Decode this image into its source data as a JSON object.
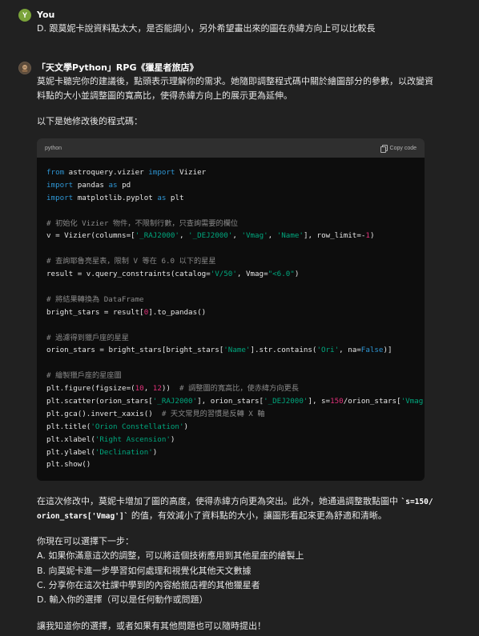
{
  "user": {
    "avatar_letter": "Y",
    "name": "You",
    "message": "D. 跟莫妮卡說資料點太大，是否能調小，另外希望畫出來的圖在赤緯方向上可以比較長"
  },
  "assistant": {
    "avatar_icon": "bot-avatar-icon",
    "name": "「天文學Python」RPG《獵星者旅店》",
    "intro_line1": "莫妮卡聽完你的建議後，點頭表示理解你的需求。她隨即調整程式碼中關於繪圖部分的參數，以改變資",
    "intro_line2": "料點的大小並調整圖的寬高比，使得赤緯方向上的展示更為延伸。",
    "lead": "以下是她修改後的程式碼：",
    "code": {
      "language": "python",
      "copy_label": "Copy code",
      "lines": [
        [
          {
            "t": "kw",
            "v": "from"
          },
          {
            "t": "fn",
            "v": " astroquery.vizier "
          },
          {
            "t": "kw",
            "v": "import"
          },
          {
            "t": "fn",
            "v": " Vizier"
          }
        ],
        [
          {
            "t": "kw",
            "v": "import"
          },
          {
            "t": "fn",
            "v": " pandas "
          },
          {
            "t": "kw",
            "v": "as"
          },
          {
            "t": "fn",
            "v": " pd"
          }
        ],
        [
          {
            "t": "kw",
            "v": "import"
          },
          {
            "t": "fn",
            "v": " matplotlib.pyplot "
          },
          {
            "t": "kw",
            "v": "as"
          },
          {
            "t": "fn",
            "v": " plt"
          }
        ],
        [],
        [
          {
            "t": "cmt",
            "v": "# 初始化 Vizier 物件，不限制行數，只查詢需要的欄位"
          }
        ],
        [
          {
            "t": "fn",
            "v": "v = Vizier(columns=["
          },
          {
            "t": "str",
            "v": "'_RAJ2000'"
          },
          {
            "t": "fn",
            "v": ", "
          },
          {
            "t": "str",
            "v": "'_DEJ2000'"
          },
          {
            "t": "fn",
            "v": ", "
          },
          {
            "t": "str",
            "v": "'Vmag'"
          },
          {
            "t": "fn",
            "v": ", "
          },
          {
            "t": "str",
            "v": "'Name'"
          },
          {
            "t": "fn",
            "v": "], row_limit=-"
          },
          {
            "t": "num",
            "v": "1"
          },
          {
            "t": "fn",
            "v": ")"
          }
        ],
        [],
        [
          {
            "t": "cmt",
            "v": "# 查詢耶魯亮星表，限制 V 等在 6.0 以下的星星"
          }
        ],
        [
          {
            "t": "fn",
            "v": "result = v.query_constraints(catalog="
          },
          {
            "t": "str",
            "v": "'V/50'"
          },
          {
            "t": "fn",
            "v": ", Vmag="
          },
          {
            "t": "str",
            "v": "\"<6.0\""
          },
          {
            "t": "fn",
            "v": ")"
          }
        ],
        [],
        [
          {
            "t": "cmt",
            "v": "# 將結果轉換為 DataFrame"
          }
        ],
        [
          {
            "t": "fn",
            "v": "bright_stars = result["
          },
          {
            "t": "num",
            "v": "0"
          },
          {
            "t": "fn",
            "v": "].to_pandas()"
          }
        ],
        [],
        [
          {
            "t": "cmt",
            "v": "# 過濾得到獵戶座的星星"
          }
        ],
        [
          {
            "t": "fn",
            "v": "orion_stars = bright_stars[bright_stars["
          },
          {
            "t": "str",
            "v": "'Name'"
          },
          {
            "t": "fn",
            "v": "].str.contains("
          },
          {
            "t": "str",
            "v": "'Ori'"
          },
          {
            "t": "fn",
            "v": ", na="
          },
          {
            "t": "kw",
            "v": "False"
          },
          {
            "t": "fn",
            "v": ")]"
          }
        ],
        [],
        [
          {
            "t": "cmt",
            "v": "# 繪製獵戶座的星座圖"
          }
        ],
        [
          {
            "t": "fn",
            "v": "plt.figure(figsize=("
          },
          {
            "t": "num",
            "v": "10"
          },
          {
            "t": "fn",
            "v": ", "
          },
          {
            "t": "num",
            "v": "12"
          },
          {
            "t": "fn",
            "v": "))  "
          },
          {
            "t": "cmt",
            "v": "# 調整圖的寬高比，使赤緯方向更長"
          }
        ],
        [
          {
            "t": "fn",
            "v": "plt.scatter(orion_stars["
          },
          {
            "t": "str",
            "v": "'_RAJ2000'"
          },
          {
            "t": "fn",
            "v": "], orion_stars["
          },
          {
            "t": "str",
            "v": "'_DEJ2000'"
          },
          {
            "t": "fn",
            "v": "], s="
          },
          {
            "t": "num",
            "v": "150"
          },
          {
            "t": "fn",
            "v": "/orion_stars["
          },
          {
            "t": "str",
            "v": "'Vmag'"
          },
          {
            "t": "fn",
            "v": "]"
          }
        ],
        [
          {
            "t": "fn",
            "v": "plt.gca().invert_xaxis()  "
          },
          {
            "t": "cmt",
            "v": "# 天文常見的習慣是反轉 X 軸"
          }
        ],
        [
          {
            "t": "fn",
            "v": "plt.title("
          },
          {
            "t": "str",
            "v": "'Orion Constellation'"
          },
          {
            "t": "fn",
            "v": ")"
          }
        ],
        [
          {
            "t": "fn",
            "v": "plt.xlabel("
          },
          {
            "t": "str",
            "v": "'Right Ascension'"
          },
          {
            "t": "fn",
            "v": ")"
          }
        ],
        [
          {
            "t": "fn",
            "v": "plt.ylabel("
          },
          {
            "t": "str",
            "v": "'Declination'"
          },
          {
            "t": "fn",
            "v": ")"
          }
        ],
        [
          {
            "t": "fn",
            "v": "plt.show()"
          }
        ]
      ]
    },
    "after_1_pre": "在這次修改中，莫妮卡增加了圖的高度，使得赤緯方向更為突出。此外，她通過調整散點圖中 ",
    "after_1_code_a": "`s=150/",
    "after_2_code_b": "orion_stars['Vmag']`",
    "after_2_post": " 的值，有效減小了資料點的大小，讓圖形看起來更為舒適和清晰。",
    "options_title": "你現在可以選擇下一步：",
    "options": [
      "A. 如果你滿意這次的調整，可以將這個技術應用到其他星座的繪製上",
      "B. 向莫妮卡進一步學習如何處理和視覺化其他天文數據",
      "C. 分享你在這次社課中學到的內容給旅店裡的其他獵星者",
      "D. 輸入你的選擇（可以是任何動作或問題）"
    ],
    "closing": "讓我知道你的選擇，或者如果有其他問題也可以隨時提出！"
  }
}
